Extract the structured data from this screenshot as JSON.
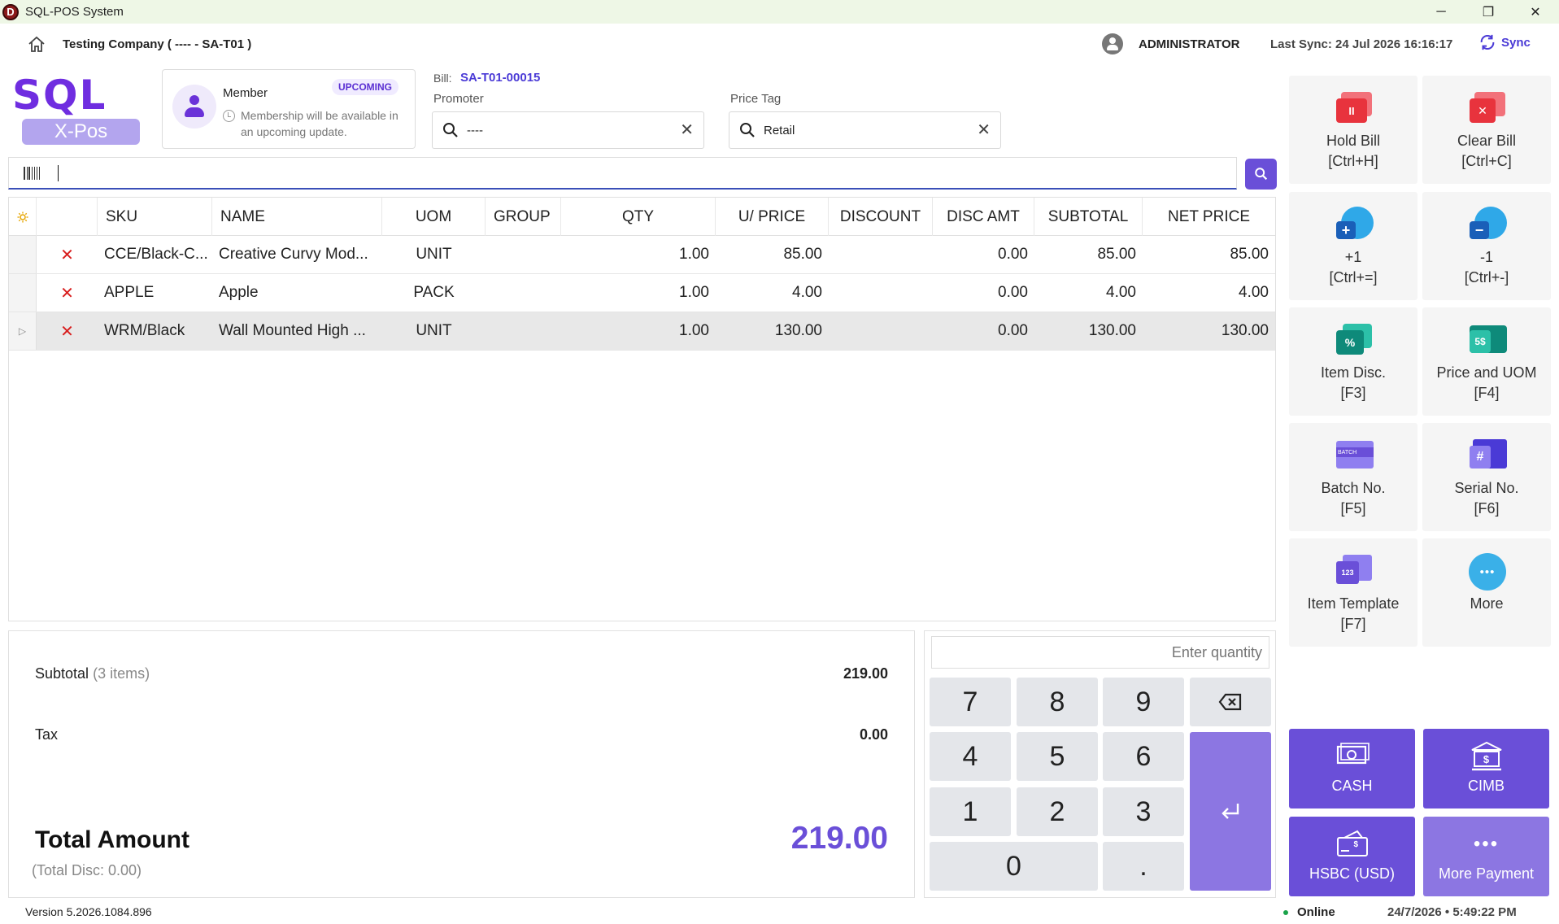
{
  "window": {
    "title": "SQL-POS System",
    "minimize_glyph": "─",
    "restore_glyph": "❐",
    "close_glyph": "✕"
  },
  "header": {
    "company": "Testing Company ( ---- - SA-T01 )",
    "user": "ADMINISTRATOR",
    "last_sync": "Last Sync: 24 Jul 2026 16:16:17",
    "sync_label": "Sync"
  },
  "brand": {
    "sql": "SQL",
    "xpos": "X-Pos"
  },
  "member": {
    "title": "Member",
    "badge": "UPCOMING",
    "note": "Membership will be available in an upcoming update."
  },
  "bill": {
    "label": "Bill:",
    "number": "SA-T01-00015"
  },
  "promoter": {
    "label": "Promoter",
    "value": "----"
  },
  "price_tag": {
    "label": "Price Tag",
    "value": "Retail"
  },
  "table": {
    "columns": {
      "sku": "SKU",
      "name": "NAME",
      "uom": "UOM",
      "group": "GROUP",
      "qty": "QTY",
      "uprice": "U/ PRICE",
      "discount": "DISCOUNT",
      "disc_amt": "DISC AMT",
      "subtotal": "SUBTOTAL",
      "net_price": "NET PRICE"
    },
    "rows": [
      {
        "sku": "CCE/Black-C...",
        "name": "Creative Curvy Mod...",
        "uom": "UNIT",
        "group": "",
        "qty": "1.00",
        "uprice": "85.00",
        "discount": "",
        "disc_amt": "0.00",
        "subtotal": "85.00",
        "net_price": "85.00"
      },
      {
        "sku": "APPLE",
        "name": "Apple",
        "uom": "PACK",
        "group": "",
        "qty": "1.00",
        "uprice": "4.00",
        "discount": "",
        "disc_amt": "0.00",
        "subtotal": "4.00",
        "net_price": "4.00"
      },
      {
        "sku": "WRM/Black",
        "name": "Wall Mounted High ...",
        "uom": "UNIT",
        "group": "",
        "qty": "1.00",
        "uprice": "130.00",
        "discount": "",
        "disc_amt": "0.00",
        "subtotal": "130.00",
        "net_price": "130.00"
      }
    ],
    "delete_glyph": "✕",
    "indicator_glyph": "▷"
  },
  "totals": {
    "subtotal_label": "Subtotal",
    "subtotal_items": "(3 items)",
    "subtotal_value": "219.00",
    "tax_label": "Tax",
    "tax_value": "0.00",
    "total_label": "Total Amount",
    "total_value": "219.00",
    "total_disc": "(Total Disc: 0.00)"
  },
  "numpad": {
    "placeholder": "Enter quantity",
    "keys": [
      "7",
      "8",
      "9",
      "4",
      "5",
      "6",
      "1",
      "2",
      "3",
      "0",
      "."
    ],
    "backspace_glyph": "⌫",
    "enter_glyph": "↵"
  },
  "actions": [
    {
      "label": "Hold Bill",
      "shortcut": "[Ctrl+H]"
    },
    {
      "label": "Clear Bill",
      "shortcut": "[Ctrl+C]"
    },
    {
      "label": "+1",
      "shortcut": "[Ctrl+=]"
    },
    {
      "label": "-1",
      "shortcut": "[Ctrl+-]"
    },
    {
      "label": "Item Disc.",
      "shortcut": "[F3]"
    },
    {
      "label": "Price and UOM",
      "shortcut": "[F4]"
    },
    {
      "label": "Batch No.",
      "shortcut": "[F5]"
    },
    {
      "label": "Serial No.",
      "shortcut": "[F6]"
    },
    {
      "label": "Item Template",
      "shortcut": "[F7]"
    },
    {
      "label": "More",
      "shortcut": ""
    }
  ],
  "icon_text": {
    "hold": "II",
    "clear": "✕",
    "plus": "+",
    "minus": "−",
    "percent": "%",
    "price": "5$",
    "batch": "BATCH",
    "hash": "#",
    "tmpl": "123",
    "more_dots": "•••",
    "cimb": "$",
    "hsbc": "$"
  },
  "payments": [
    {
      "label": "CASH"
    },
    {
      "label": "CIMB"
    },
    {
      "label": "HSBC (USD)"
    },
    {
      "label": "More Payment"
    }
  ],
  "status": {
    "version": "Version 5.2026.1084.896",
    "online": "Online",
    "datetime": "24/7/2026  •  5:49:22 PM"
  },
  "colors": {
    "accent": "#6a4fd8",
    "accent_light": "#8c76e2",
    "delete": "#d81e1e"
  }
}
